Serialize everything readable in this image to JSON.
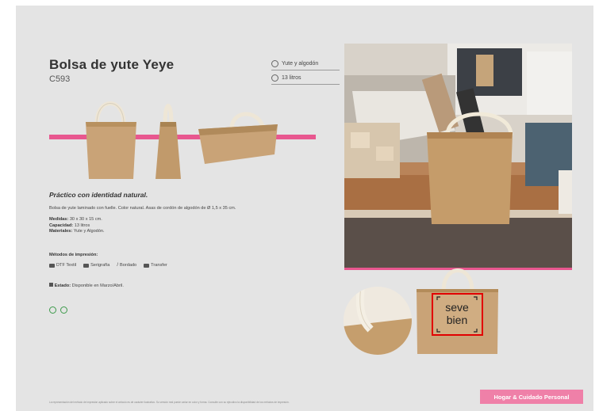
{
  "product": {
    "title": "Bolsa de yute Yeye",
    "code": "C593"
  },
  "specs": [
    {
      "icon": "material-icon",
      "label": "Yute y algodón"
    },
    {
      "icon": "capacity-icon",
      "label": "13 litros"
    }
  ],
  "description": {
    "heading": "Práctico con identidad natural.",
    "body": "Bolsa de yute laminado con fuelle. Color natural. Asas de cordón de algodón de Ø 1,5 x 35 cm.",
    "measures_label": "Medidas:",
    "measures_value": "30 x 30 x 15 cm.",
    "capacity_label": "Capacidad:",
    "capacity_value": "13 litros",
    "materials_label": "Materiales:",
    "materials_value": "Yute y Algodón."
  },
  "printing": {
    "heading": "Métodos de impresión:",
    "methods": [
      "DTF Textil",
      "Serigrafía",
      "Bordado",
      "Transfer"
    ]
  },
  "status": {
    "label": "Estado:",
    "value": "Disponible en Marzo/Abril."
  },
  "logo_text": {
    "line1": "seve",
    "line2": "bien"
  },
  "footer_note": "La representación del método de impresión aplicado sobre el artículo es de carácter ilustrativo. Su versión real puede variar en color y forma. Consulte con su ejecutivo la disponibilidad de los métodos de impresión.",
  "category_badge": "Hogar & Cuidado Personal",
  "colors": {
    "accent": "#e8578f",
    "badge": "#ef80a8",
    "jute": "#c9a377"
  }
}
